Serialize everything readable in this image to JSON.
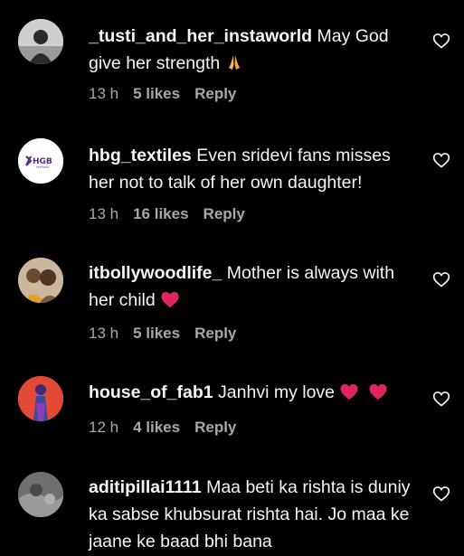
{
  "comments": [
    {
      "username": "_tusti_and_her_instaworld",
      "text": "May God give her strength",
      "emoji": "pray",
      "time": "13 h",
      "likes": "5 likes",
      "reply": "Reply"
    },
    {
      "username": "hbg_textiles",
      "text": "Even sridevi fans misses her not to talk of her own daughter!",
      "avatar_logo": "HGB",
      "avatar_subtext": "TEXTILES",
      "time": "13 h",
      "likes": "16 likes",
      "reply": "Reply"
    },
    {
      "username": "itbollywoodlife_",
      "text": "Mother is always with her child",
      "emoji": "red-heart",
      "time": "13 h",
      "likes": "5 likes",
      "reply": "Reply"
    },
    {
      "username": "house_of_fab1",
      "text": "Janhvi my love",
      "emoji": "red-heart-x2",
      "time": "12 h",
      "likes": "4 likes",
      "reply": "Reply"
    },
    {
      "username": "aditipillai1111",
      "text": "Maa beti ka rishta is duniy ka sabse khubsurat rishta hai. Jo maa ke jaane ke baad bhi bana"
    }
  ],
  "colors": {
    "background": "#000000",
    "text": "#f5f5f5",
    "meta": "#a8a8a8",
    "heart_emoji": "#e0245e",
    "hgb_logo": "#5b2b8c"
  },
  "icons": {
    "like": "heart-outline-icon"
  }
}
